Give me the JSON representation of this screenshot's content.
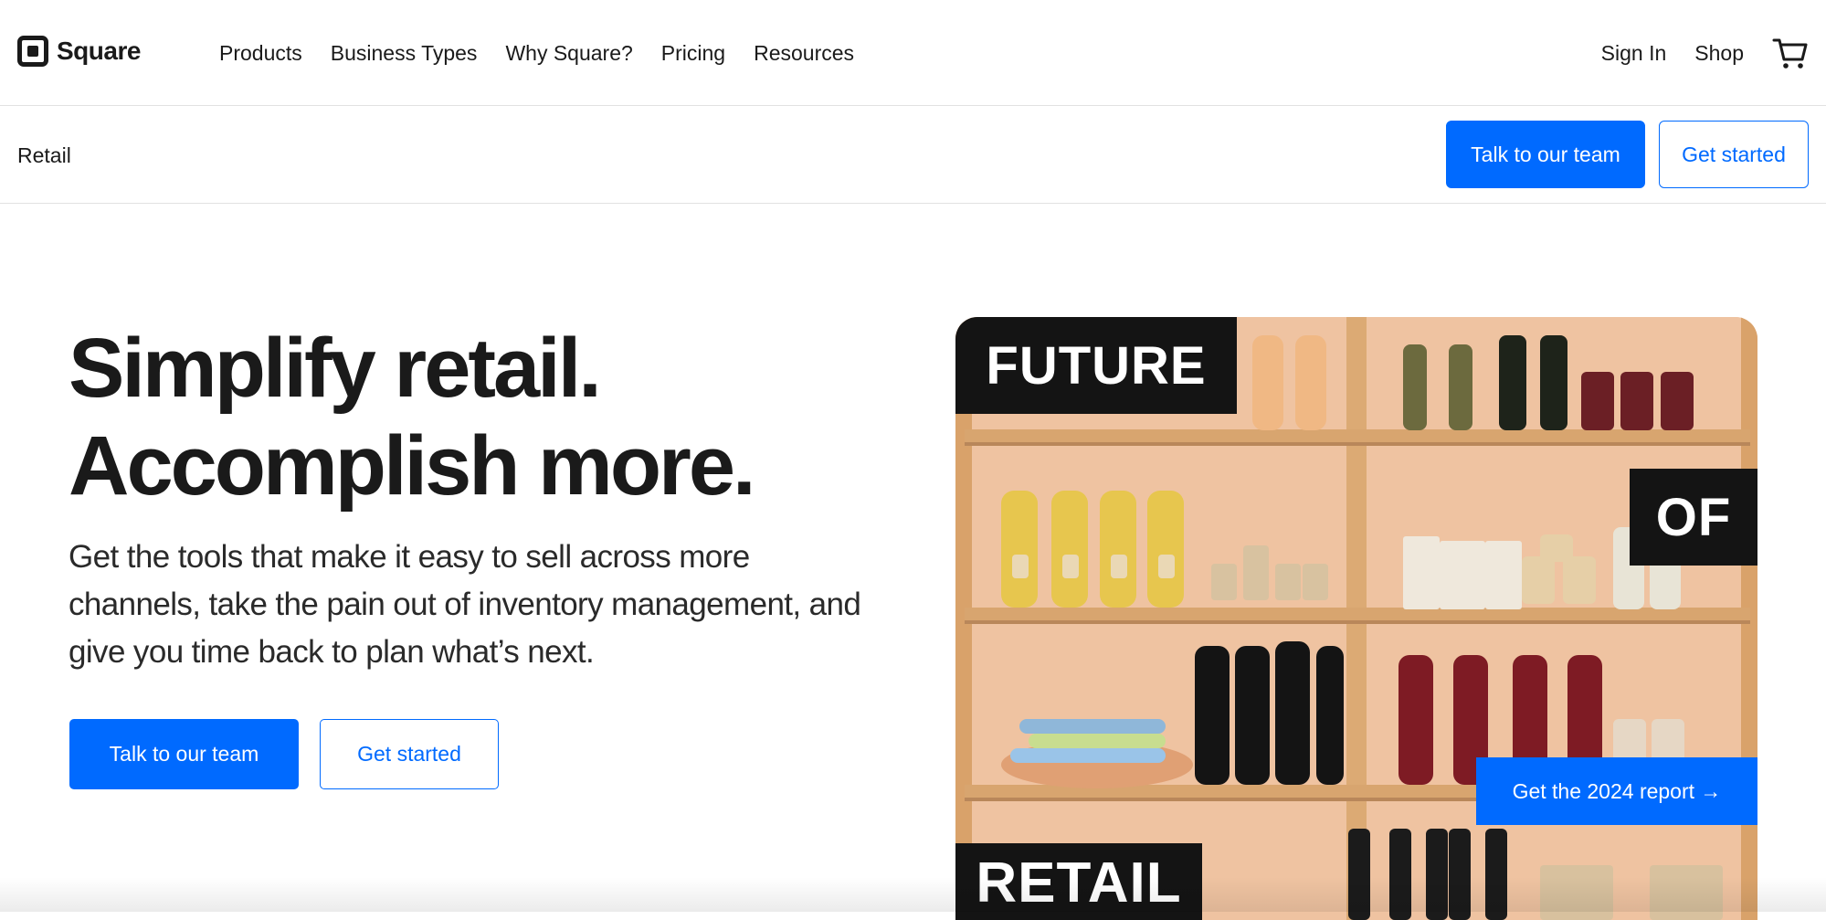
{
  "brand": {
    "name": "Square"
  },
  "nav": {
    "links": [
      "Products",
      "Business Types",
      "Why Square?",
      "Pricing",
      "Resources"
    ],
    "sign_in": "Sign In",
    "shop": "Shop",
    "cart_icon": "cart-icon"
  },
  "subnav": {
    "title": "Retail",
    "talk_button": "Talk to our team",
    "start_button": "Get started"
  },
  "hero": {
    "headline_line1": "Simplify retail.",
    "headline_line2": "Accomplish more.",
    "subtext": "Get the tools that make it easy to sell across more channels, take the pain out of inventory management, and give you time back to plan what’s next.",
    "talk_button": "Talk to our team",
    "start_button": "Get started"
  },
  "promo": {
    "word1": "FUTURE",
    "word2": "OF",
    "word3": "RETAIL",
    "report_button": "Get the 2024 report →"
  },
  "colors": {
    "accent": "#006aff",
    "text": "#1a1a1a",
    "label_bg": "#141414"
  }
}
